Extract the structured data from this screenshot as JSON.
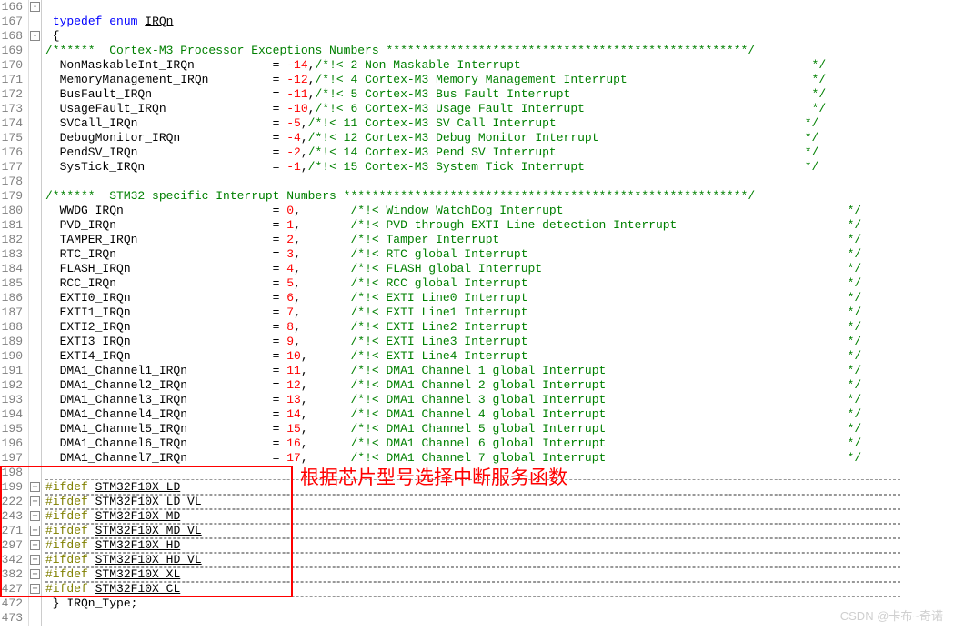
{
  "annotation": "根据芯片型号选择中断服务函数",
  "watermark": "CSDN @卡布~奇诺",
  "header1": "/******  Cortex-M3 Processor Exceptions Numbers ***************************************************/",
  "header2": "/******  STM32 specific Interrupt Numbers *********************************************************/",
  "typedef": "typedef",
  "enum": "enum",
  "irqn": "IRQn",
  "brace_open": "{",
  "irqn_type": "} IRQn_Type;",
  "ifdef": "#ifdef",
  "entries": [
    {
      "name": "NonMaskableInt_IRQn",
      "val": "-14",
      "c": "/*!< 2 Non Maskable Interrupt"
    },
    {
      "name": "MemoryManagement_IRQn",
      "val": "-12",
      "c": "/*!< 4 Cortex-M3 Memory Management Interrupt"
    },
    {
      "name": "BusFault_IRQn",
      "val": "-11",
      "c": "/*!< 5 Cortex-M3 Bus Fault Interrupt"
    },
    {
      "name": "UsageFault_IRQn",
      "val": "-10",
      "c": "/*!< 6 Cortex-M3 Usage Fault Interrupt"
    },
    {
      "name": "SVCall_IRQn",
      "val": "-5",
      "c": "/*!< 11 Cortex-M3 SV Call Interrupt"
    },
    {
      "name": "DebugMonitor_IRQn",
      "val": "-4",
      "c": "/*!< 12 Cortex-M3 Debug Monitor Interrupt"
    },
    {
      "name": "PendSV_IRQn",
      "val": "-2",
      "c": "/*!< 14 Cortex-M3 Pend SV Interrupt"
    },
    {
      "name": "SysTick_IRQn",
      "val": "-1",
      "c": "/*!< 15 Cortex-M3 System Tick Interrupt"
    }
  ],
  "entries2": [
    {
      "name": "WWDG_IRQn",
      "val": "0",
      "c": "/*!< Window WatchDog Interrupt"
    },
    {
      "name": "PVD_IRQn",
      "val": "1",
      "c": "/*!< PVD through EXTI Line detection Interrupt"
    },
    {
      "name": "TAMPER_IRQn",
      "val": "2",
      "c": "/*!< Tamper Interrupt"
    },
    {
      "name": "RTC_IRQn",
      "val": "3",
      "c": "/*!< RTC global Interrupt"
    },
    {
      "name": "FLASH_IRQn",
      "val": "4",
      "c": "/*!< FLASH global Interrupt"
    },
    {
      "name": "RCC_IRQn",
      "val": "5",
      "c": "/*!< RCC global Interrupt"
    },
    {
      "name": "EXTI0_IRQn",
      "val": "6",
      "c": "/*!< EXTI Line0 Interrupt"
    },
    {
      "name": "EXTI1_IRQn",
      "val": "7",
      "c": "/*!< EXTI Line1 Interrupt"
    },
    {
      "name": "EXTI2_IRQn",
      "val": "8",
      "c": "/*!< EXTI Line2 Interrupt"
    },
    {
      "name": "EXTI3_IRQn",
      "val": "9",
      "c": "/*!< EXTI Line3 Interrupt"
    },
    {
      "name": "EXTI4_IRQn",
      "val": "10",
      "c": "/*!< EXTI Line4 Interrupt"
    },
    {
      "name": "DMA1_Channel1_IRQn",
      "val": "11",
      "c": "/*!< DMA1 Channel 1 global Interrupt"
    },
    {
      "name": "DMA1_Channel2_IRQn",
      "val": "12",
      "c": "/*!< DMA1 Channel 2 global Interrupt"
    },
    {
      "name": "DMA1_Channel3_IRQn",
      "val": "13",
      "c": "/*!< DMA1 Channel 3 global Interrupt"
    },
    {
      "name": "DMA1_Channel4_IRQn",
      "val": "14",
      "c": "/*!< DMA1 Channel 4 global Interrupt"
    },
    {
      "name": "DMA1_Channel5_IRQn",
      "val": "15",
      "c": "/*!< DMA1 Channel 5 global Interrupt"
    },
    {
      "name": "DMA1_Channel6_IRQn",
      "val": "16",
      "c": "/*!< DMA1 Channel 6 global Interrupt"
    },
    {
      "name": "DMA1_Channel7_IRQn",
      "val": "17",
      "c": "/*!< DMA1 Channel 7 global Interrupt"
    }
  ],
  "ifdefs": [
    {
      "ln": "199",
      "sym": "STM32F10X_LD"
    },
    {
      "ln": "222",
      "sym": "STM32F10X_LD_VL"
    },
    {
      "ln": "243",
      "sym": "STM32F10X_MD"
    },
    {
      "ln": "271",
      "sym": "STM32F10X_MD_VL"
    },
    {
      "ln": "297",
      "sym": "STM32F10X_HD"
    },
    {
      "ln": "342",
      "sym": "STM32F10X_HD_VL"
    },
    {
      "ln": "382",
      "sym": "STM32F10X_XL"
    },
    {
      "ln": "427",
      "sym": "STM32F10X_CL"
    }
  ],
  "lines_top": [
    "166",
    "167",
    "168",
    "169",
    "170",
    "171",
    "172",
    "173",
    "174",
    "175",
    "176",
    "177",
    "178",
    "179",
    "180",
    "181",
    "182",
    "183",
    "184",
    "185",
    "186",
    "187",
    "188",
    "189",
    "190",
    "191",
    "192",
    "193",
    "194",
    "195",
    "196",
    "197",
    "198"
  ],
  "lines_bottom": [
    "472",
    "473"
  ],
  "comment_end": "*/"
}
